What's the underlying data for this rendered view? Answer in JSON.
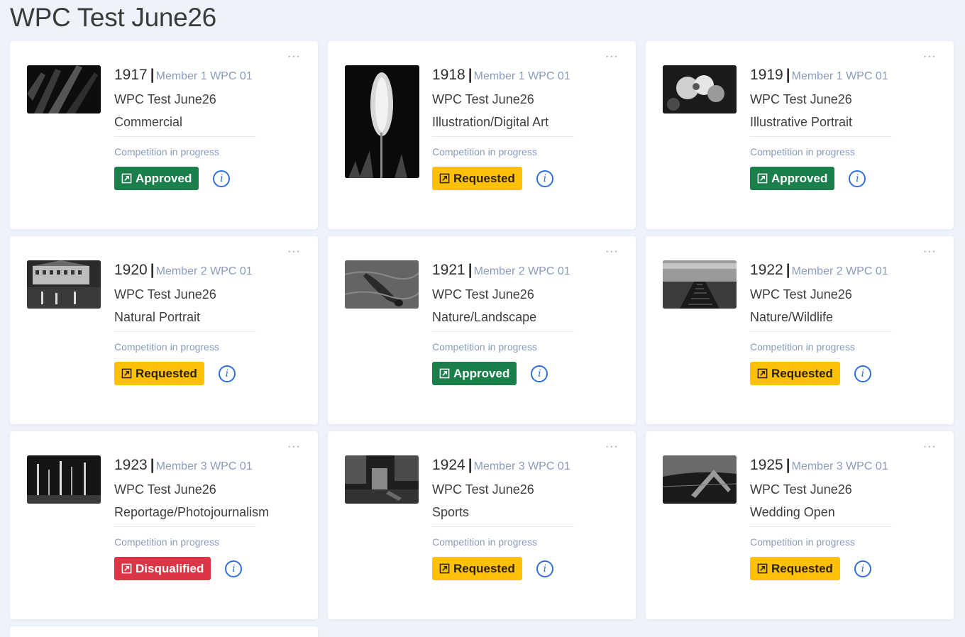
{
  "page": {
    "title": "WPC Test June26"
  },
  "common": {
    "more_label": "···",
    "info_label": "i"
  },
  "cards": [
    {
      "id": "1917",
      "sep": "|",
      "member": "Member 1 WPC 01",
      "competition": "WPC Test June26",
      "category": "Commercial",
      "status_text": "Competition in progress",
      "badge": "Approved",
      "badge_type": "approved"
    },
    {
      "id": "1918",
      "sep": "|",
      "member": "Member 1 WPC 01",
      "competition": "WPC Test June26",
      "category": "Illustration/Digital Art",
      "status_text": "Competition in progress",
      "badge": "Requested",
      "badge_type": "requested"
    },
    {
      "id": "1919",
      "sep": "|",
      "member": "Member 1 WPC 01",
      "competition": "WPC Test June26",
      "category": "Illustrative Portrait",
      "status_text": "Competition in progress",
      "badge": "Approved",
      "badge_type": "approved"
    },
    {
      "id": "1920",
      "sep": "|",
      "member": "Member 2 WPC 01",
      "competition": "WPC Test June26",
      "category": "Natural Portrait",
      "status_text": "Competition in progress",
      "badge": "Requested",
      "badge_type": "requested"
    },
    {
      "id": "1921",
      "sep": "|",
      "member": "Member 2 WPC 01",
      "competition": "WPC Test June26",
      "category": "Nature/Landscape",
      "status_text": "Competition in progress",
      "badge": "Approved",
      "badge_type": "approved"
    },
    {
      "id": "1922",
      "sep": "|",
      "member": "Member 2 WPC 01",
      "competition": "WPC Test June26",
      "category": "Nature/Wildlife",
      "status_text": "Competition in progress",
      "badge": "Requested",
      "badge_type": "requested"
    },
    {
      "id": "1923",
      "sep": "|",
      "member": "Member 3 WPC 01",
      "competition": "WPC Test June26",
      "category": "Reportage/Photojournalism",
      "status_text": "Competition in progress",
      "badge": "Disqualified",
      "badge_type": "disqualified"
    },
    {
      "id": "1924",
      "sep": "|",
      "member": "Member 3 WPC 01",
      "competition": "WPC Test June26",
      "category": "Sports",
      "status_text": "Competition in progress",
      "badge": "Requested",
      "badge_type": "requested"
    },
    {
      "id": "1925",
      "sep": "|",
      "member": "Member 3 WPC 01",
      "competition": "WPC Test June26",
      "category": "Wedding Open",
      "status_text": "Competition in progress",
      "badge": "Requested",
      "badge_type": "requested"
    }
  ],
  "colors": {
    "approved": "#1a7f4b",
    "requested": "#ffc107",
    "disqualified": "#dc3545",
    "member_text": "#8a9bbd",
    "info_icon": "#2f6fe0"
  }
}
